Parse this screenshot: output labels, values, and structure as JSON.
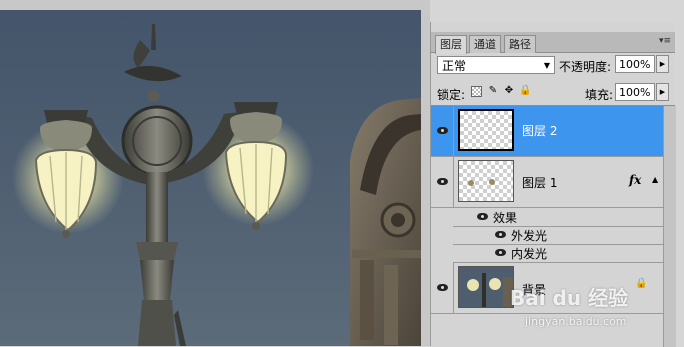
{
  "panel": {
    "tabs": [
      {
        "label": "图层",
        "active": true
      },
      {
        "label": "通道",
        "active": false
      },
      {
        "label": "路径",
        "active": false
      }
    ],
    "blend_mode": "正常",
    "opacity_label": "不透明度:",
    "opacity_value": "100%",
    "lock_label": "锁定:",
    "fill_label": "填充:",
    "fill_value": "100%"
  },
  "layers": {
    "layer2": {
      "name": "图层 2",
      "selected": true,
      "visible": true
    },
    "layer1": {
      "name": "图层 1",
      "visible": true,
      "fx": "fx"
    },
    "effects": {
      "label": "效果"
    },
    "outer_glow": {
      "label": "外发光"
    },
    "inner_glow": {
      "label": "内发光"
    },
    "background": {
      "name": "背景",
      "locked": true
    }
  },
  "watermark": {
    "brand": "Bai du 经验",
    "url": "jingyan.baidu.com"
  },
  "colors": {
    "selection": "#3d95ee",
    "sky": "#4a5a6b",
    "glow": "#f4f1c2"
  },
  "icons": {
    "eye": "eye-icon",
    "lock": "lock-icon",
    "brush": "brush-icon",
    "move": "move-icon",
    "panel_menu": "panel-menu-icon"
  }
}
